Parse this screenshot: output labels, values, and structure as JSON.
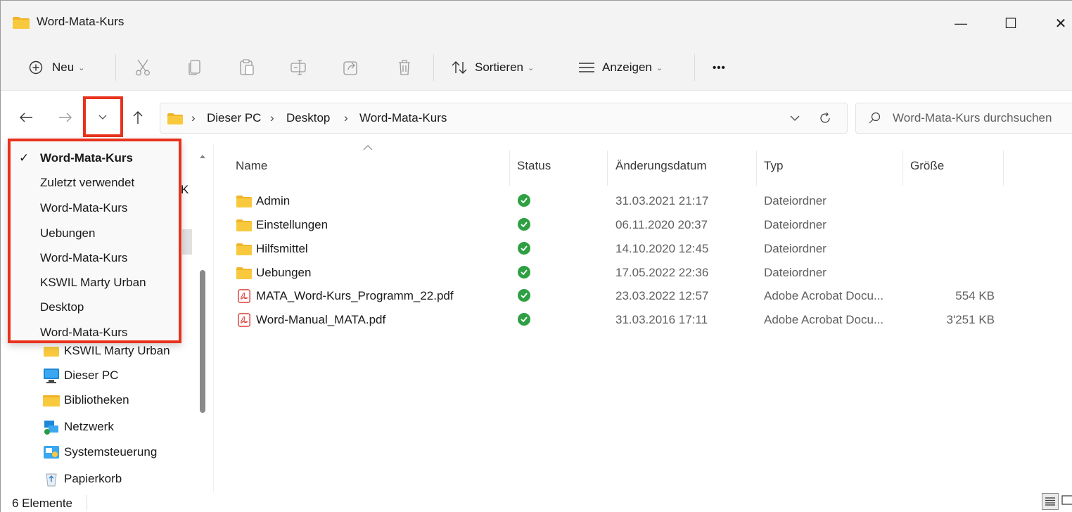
{
  "window": {
    "title": "Word-Mata-Kurs",
    "minimize_glyph": "—",
    "maximize_glyph": "☐",
    "close_glyph": "✕"
  },
  "toolbar": {
    "new_label": "Neu",
    "sort_label": "Sortieren",
    "view_label": "Anzeigen",
    "more_label": "•••",
    "icons": [
      "plus-circle-icon",
      "cut-icon",
      "copy-icon",
      "paste-icon",
      "rename-icon",
      "share-icon",
      "delete-icon",
      "sort-icon",
      "view-icon",
      "more-icon"
    ]
  },
  "address": {
    "sep": "›",
    "crumbs": [
      "Dieser PC",
      "Desktop",
      "Word-Mata-Kurs"
    ],
    "search_placeholder": "Word-Mata-Kurs durchsuchen"
  },
  "recent_menu": {
    "check": "✓",
    "items": [
      {
        "label": "Word-Mata-Kurs",
        "current": true
      },
      {
        "label": "Zuletzt verwendet",
        "current": false
      },
      {
        "label": "Word-Mata-Kurs",
        "current": false
      },
      {
        "label": "Uebungen",
        "current": false
      },
      {
        "label": "Word-Mata-Kurs",
        "current": false
      },
      {
        "label": "KSWIL Marty Urban",
        "current": false
      },
      {
        "label": "Desktop",
        "current": false
      },
      {
        "label": "Word-Mata-Kurs",
        "current": false
      }
    ]
  },
  "sidebar": {
    "partial_text": "K",
    "items": [
      {
        "label": "KSWIL Marty Urban",
        "icon": "folder-icon"
      },
      {
        "label": "Dieser PC",
        "icon": "computer-icon"
      },
      {
        "label": "Bibliotheken",
        "icon": "libraries-icon"
      },
      {
        "label": "Netzwerk",
        "icon": "network-icon"
      },
      {
        "label": "Systemsteuerung",
        "icon": "control-panel-icon"
      },
      {
        "label": "Papierkorb",
        "icon": "recycle-bin-icon"
      }
    ]
  },
  "files": {
    "columns": {
      "name": "Name",
      "status": "Status",
      "date": "Änderungsdatum",
      "type": "Typ",
      "size": "Größe"
    },
    "rows": [
      {
        "name": "Admin",
        "date": "31.03.2021 21:17",
        "type": "Dateiordner",
        "size": "",
        "kind": "folder"
      },
      {
        "name": "Einstellungen",
        "date": "06.11.2020 20:37",
        "type": "Dateiordner",
        "size": "",
        "kind": "folder"
      },
      {
        "name": "Hilfsmittel",
        "date": "14.10.2020 12:45",
        "type": "Dateiordner",
        "size": "",
        "kind": "folder"
      },
      {
        "name": "Uebungen",
        "date": "17.05.2022 22:36",
        "type": "Dateiordner",
        "size": "",
        "kind": "folder"
      },
      {
        "name": "MATA_Word-Kurs_Programm_22.pdf",
        "date": "23.03.2022 12:57",
        "type": "Adobe Acrobat Docu...",
        "size": "554 KB",
        "kind": "pdf"
      },
      {
        "name": "Word-Manual_MATA.pdf",
        "date": "31.03.2016 17:11",
        "type": "Adobe Acrobat Docu...",
        "size": "3'251 KB",
        "kind": "pdf"
      }
    ]
  },
  "statusbar": {
    "count": "6 Elemente"
  },
  "colors": {
    "highlight": "#e8321c",
    "folder": "#f8c93d",
    "status_ok": "#2ea043",
    "pdf": "#d9302c"
  }
}
